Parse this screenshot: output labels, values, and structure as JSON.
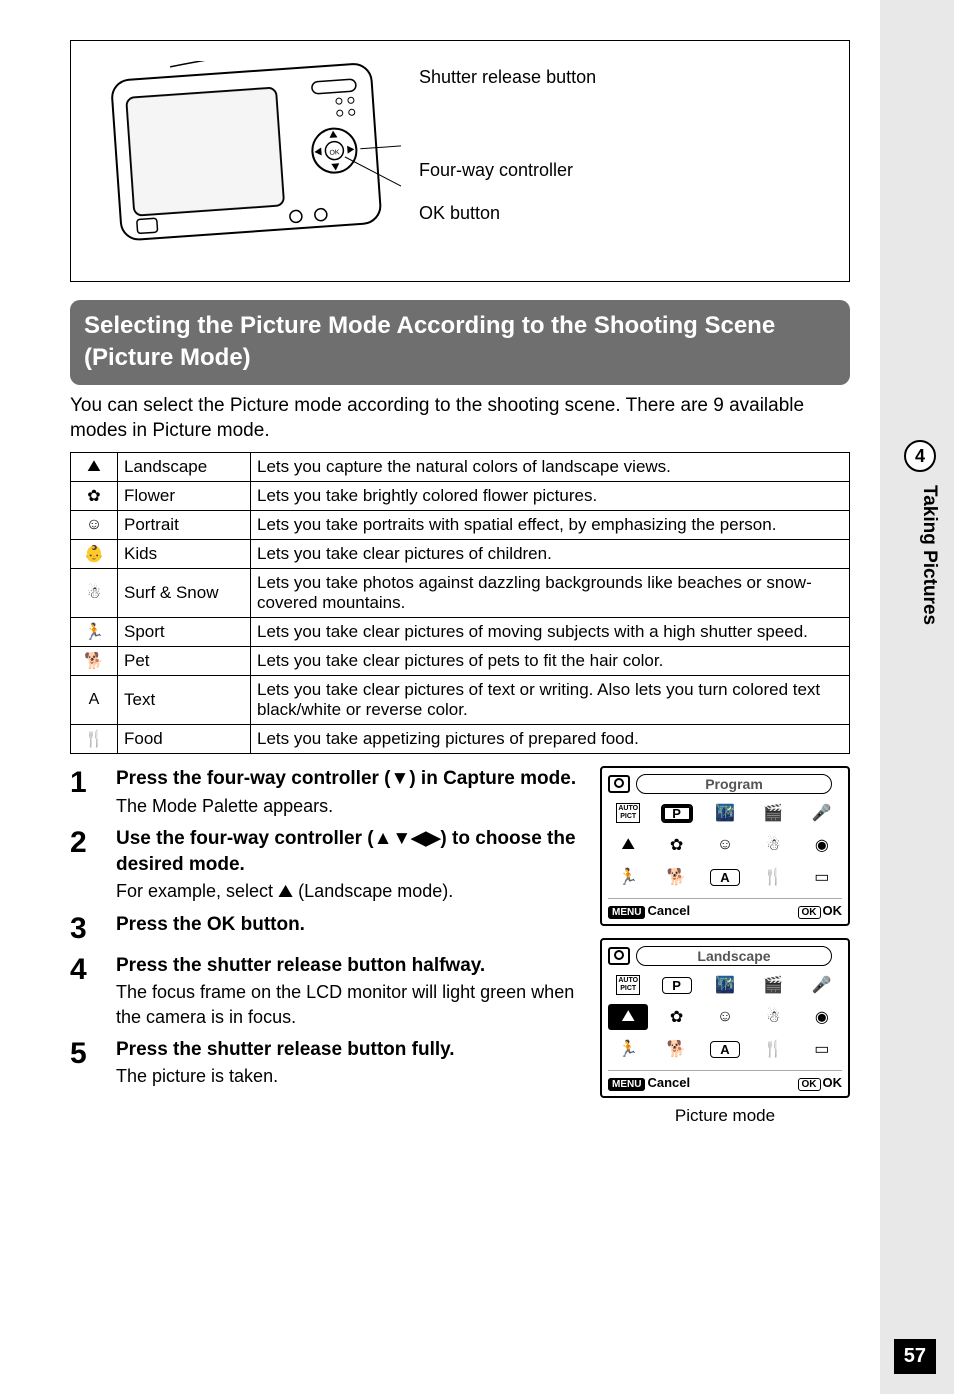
{
  "sidebar": {
    "chapter": "4",
    "label": "Taking Pictures",
    "page_number": "57"
  },
  "diagram": {
    "callout1": "Shutter release button",
    "callout2": "Four-way controller",
    "callout3": "OK button"
  },
  "section_title": "Selecting the Picture Mode According to the Shooting Scene (Picture Mode)",
  "intro": "You can select the Picture mode according to the shooting scene. There are 9 available modes in Picture mode.",
  "modes": [
    {
      "icon": "⛰",
      "name": "Landscape",
      "desc": "Lets you capture the natural colors of landscape views."
    },
    {
      "icon": "✿",
      "name": "Flower",
      "desc": "Lets you take brightly colored flower pictures."
    },
    {
      "icon": "☺",
      "name": "Portrait",
      "desc": "Lets you take portraits with spatial effect, by emphasizing the person."
    },
    {
      "icon": "👶",
      "name": "Kids",
      "desc": "Lets you take clear pictures of children."
    },
    {
      "icon": "☃",
      "name": "Surf & Snow",
      "desc": "Lets you take photos against dazzling backgrounds like beaches or snow-covered mountains."
    },
    {
      "icon": "🏃",
      "name": "Sport",
      "desc": "Lets you take clear pictures of moving subjects with a high shutter speed."
    },
    {
      "icon": "🐕",
      "name": "Pet",
      "desc": "Lets you take clear pictures of pets to fit the hair color."
    },
    {
      "icon": "A",
      "name": "Text",
      "desc": "Lets you take clear pictures of text or writing. Also lets you turn colored text black/white or reverse color."
    },
    {
      "icon": "🍴",
      "name": "Food",
      "desc": "Lets you take appetizing pictures of prepared food."
    }
  ],
  "steps": [
    {
      "num": "1",
      "title": "Press the four-way controller (▼) in Capture mode.",
      "desc": "The Mode Palette appears."
    },
    {
      "num": "2",
      "title": "Use the four-way controller (▲▼◀▶) to choose the desired mode.",
      "desc": "For example, select ⛰ (Landscape mode)."
    },
    {
      "num": "3",
      "title": "Press the OK button.",
      "desc": ""
    },
    {
      "num": "4",
      "title": "Press the shutter release button halfway.",
      "desc": "The focus frame on the LCD monitor will light green when the camera is in focus."
    },
    {
      "num": "5",
      "title": "Press the shutter release button fully.",
      "desc": "The picture is taken."
    }
  ],
  "screens": {
    "program": {
      "title": "Program",
      "cancel": "Cancel",
      "ok": "OK",
      "menu": "MENU",
      "okbtn": "OK",
      "autopict": "AUTO\nPICT",
      "selected": "P"
    },
    "landscape": {
      "title": "Landscape",
      "cancel": "Cancel",
      "ok": "OK",
      "menu": "MENU",
      "okbtn": "OK",
      "autopict": "AUTO\nPICT",
      "selected": "⛰"
    },
    "picture_mode_label": "Picture mode"
  },
  "chart_data": null
}
